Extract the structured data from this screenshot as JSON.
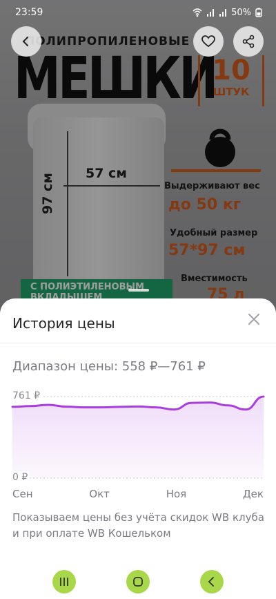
{
  "status_bar": {
    "time": "23:59",
    "battery": "50%"
  },
  "hero": {
    "subtitle": "ПОЛИПРОПИЛЕНОВЫЕ",
    "title": "МЕШКИ",
    "quantity_number": "10",
    "quantity_unit": "ШТУК",
    "width_label": "57 см",
    "height_label": "97 см",
    "feature1_label": "Выдерживают вес",
    "feature1_value": "до 50 кг",
    "feature2_label": "Удобный размер",
    "feature2_value": "57*97 см",
    "feature3_label": "Вместимость",
    "feature3_value": "75 л",
    "tag": "С ПОЛИЭТИЛЕНОВЫМ ВКЛАДЫШЕМ"
  },
  "sheet": {
    "title": "История цены",
    "range": "Диапазон цены: 558 ₽—761 ₽",
    "note": "Показываем цены без учёта скидок WB клуба и при оплате WB Кошельком"
  },
  "chart_data": {
    "type": "area",
    "ylim": [
      0,
      761
    ],
    "y_ticks": [
      "761 ₽",
      "0 ₽"
    ],
    "x_ticks": [
      "Сен",
      "Окт",
      "Ноя",
      "Дек"
    ],
    "values": [
      665,
      672,
      684,
      667,
      660,
      660,
      665,
      668,
      660,
      640,
      702,
      705,
      679,
      640,
      761
    ],
    "color": "#a83ee0"
  }
}
